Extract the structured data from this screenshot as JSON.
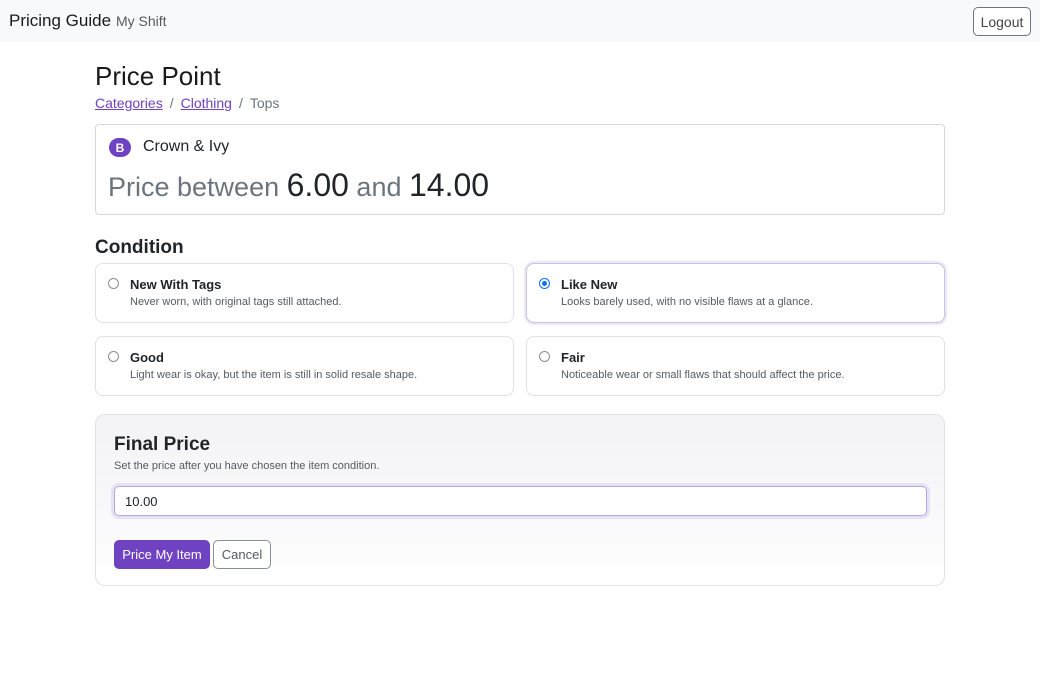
{
  "navbar": {
    "brand": "Pricing Guide",
    "nav_link": "My Shift",
    "logout_label": "Logout"
  },
  "page": {
    "title": "Price Point"
  },
  "breadcrumb": {
    "items": [
      "Categories",
      "Clothing",
      "Tops"
    ],
    "separator": "/"
  },
  "brand_card": {
    "badge": "B",
    "brand_name": "Crown & Ivy",
    "price_prefix": "Price between",
    "price_min": "6.00",
    "price_joiner": "and",
    "price_max": "14.00"
  },
  "condition": {
    "section_title": "Condition",
    "selected": "Like New",
    "options": [
      {
        "title": "New With Tags",
        "description": "Never worn, with original tags still attached.",
        "checked": false
      },
      {
        "title": "Like New",
        "description": "Looks barely used, with no visible flaws at a glance.",
        "checked": true
      },
      {
        "title": "Good",
        "description": "Light wear is okay, but the item is still in solid resale shape.",
        "checked": false
      },
      {
        "title": "Fair",
        "description": "Noticeable wear or small flaws that should affect the price.",
        "checked": false
      }
    ]
  },
  "final_price": {
    "title": "Final Price",
    "subtitle": "Set the price after you have chosen the item condition.",
    "value": "10.00",
    "submit_label": "Price My Item",
    "cancel_label": "Cancel"
  },
  "colors": {
    "accent": "#6f42c1",
    "radio_checked": "#0d6efd",
    "navbar_bg": "#f8f9fa"
  }
}
